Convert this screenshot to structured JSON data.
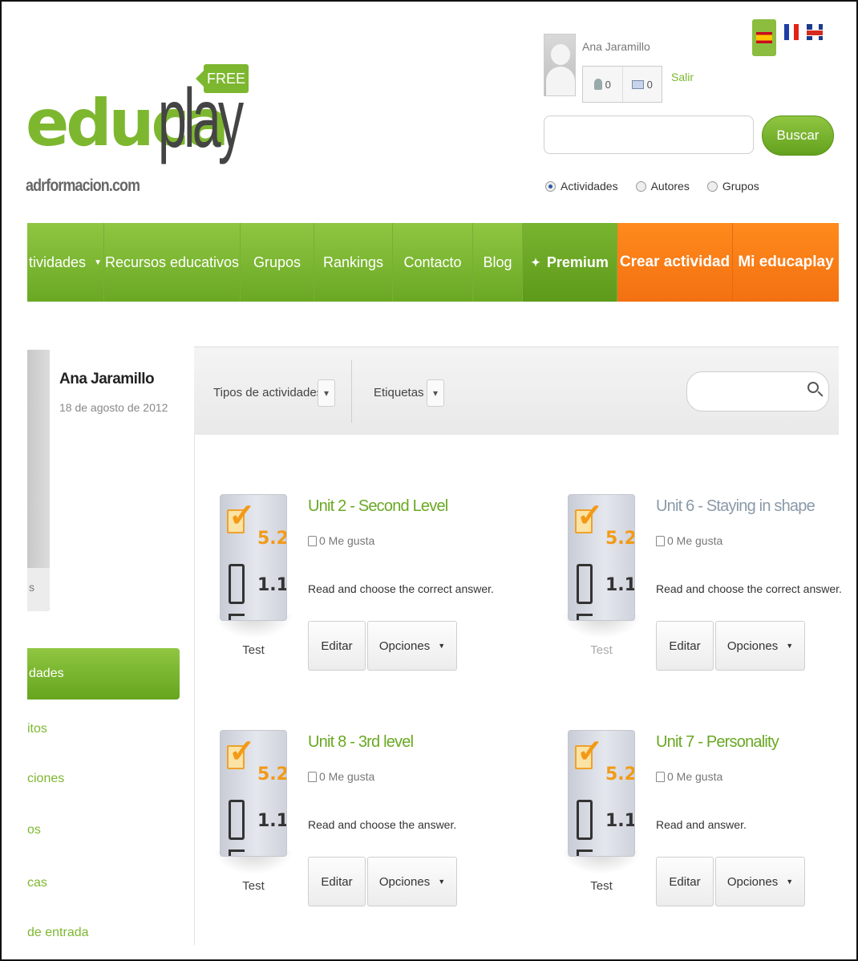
{
  "header": {
    "logo_main": "educa",
    "logo_play": "play",
    "logo_sub": "adrformacion.com",
    "logo_badge": "FREE",
    "user_name": "Ana Jaramillo",
    "notifications_count": "0",
    "messages_count": "0",
    "logout_label": "Salir",
    "search_placeholder": "",
    "search_button": "Buscar",
    "search_scope": [
      {
        "label": "Actividades",
        "selected": true
      },
      {
        "label": "Autores",
        "selected": false
      },
      {
        "label": "Grupos",
        "selected": false
      }
    ],
    "languages": [
      {
        "icon": "flag-spain-icon",
        "active": true
      },
      {
        "icon": "flag-france-icon",
        "active": false
      },
      {
        "icon": "flag-uk-icon",
        "active": false
      }
    ]
  },
  "nav": [
    {
      "label": "tividades",
      "dropdown": true
    },
    {
      "label": "Recursos educativos"
    },
    {
      "label": "Grupos"
    },
    {
      "label": "Rankings"
    },
    {
      "label": "Contacto"
    },
    {
      "label": "Blog"
    },
    {
      "label": "Premium",
      "icon": "star-icon"
    },
    {
      "label": "Crear actividad"
    },
    {
      "label": "Mi educaplay"
    }
  ],
  "profile": {
    "name": "Ana Jaramillo",
    "joined": "18 de agosto de 2012",
    "photo_caption": "s"
  },
  "sidebar": {
    "active": "dades",
    "items": [
      "itos",
      "ciones",
      "os",
      "cas",
      "de entrada"
    ]
  },
  "filters": {
    "types_label": "Tipos de actividades",
    "tags_label": "Etiquetas",
    "search_placeholder": ""
  },
  "activities": [
    {
      "title": "Unit 2 - Second Level",
      "likes": "0 Me gusta",
      "description": "Read and choose the correct answer.",
      "type": "Test",
      "edit": "Editar",
      "options": "Opciones"
    },
    {
      "title": "Unit 6 - Staying in shape",
      "likes": "0 Me gusta",
      "description": "Read and choose the correct answer.",
      "type": "Test",
      "edit": "Editar",
      "options": "Opciones"
    },
    {
      "title": "Unit 8 - 3rd level",
      "likes": "0 Me gusta",
      "description": "Read and choose the answer.",
      "type": "Test",
      "edit": "Editar",
      "options": "Opciones"
    },
    {
      "title": "Unit 7 - Personality",
      "likes": "0 Me gusta",
      "description": "Read and answer.",
      "type": "Test",
      "edit": "Editar",
      "options": "Opciones"
    }
  ],
  "thumb_text": {
    "score": "5.2",
    "second": "1.1"
  },
  "colors": {
    "brand_green": "#7db72f",
    "accent_orange": "#f37012",
    "muted_title": "#8a9aa8"
  }
}
